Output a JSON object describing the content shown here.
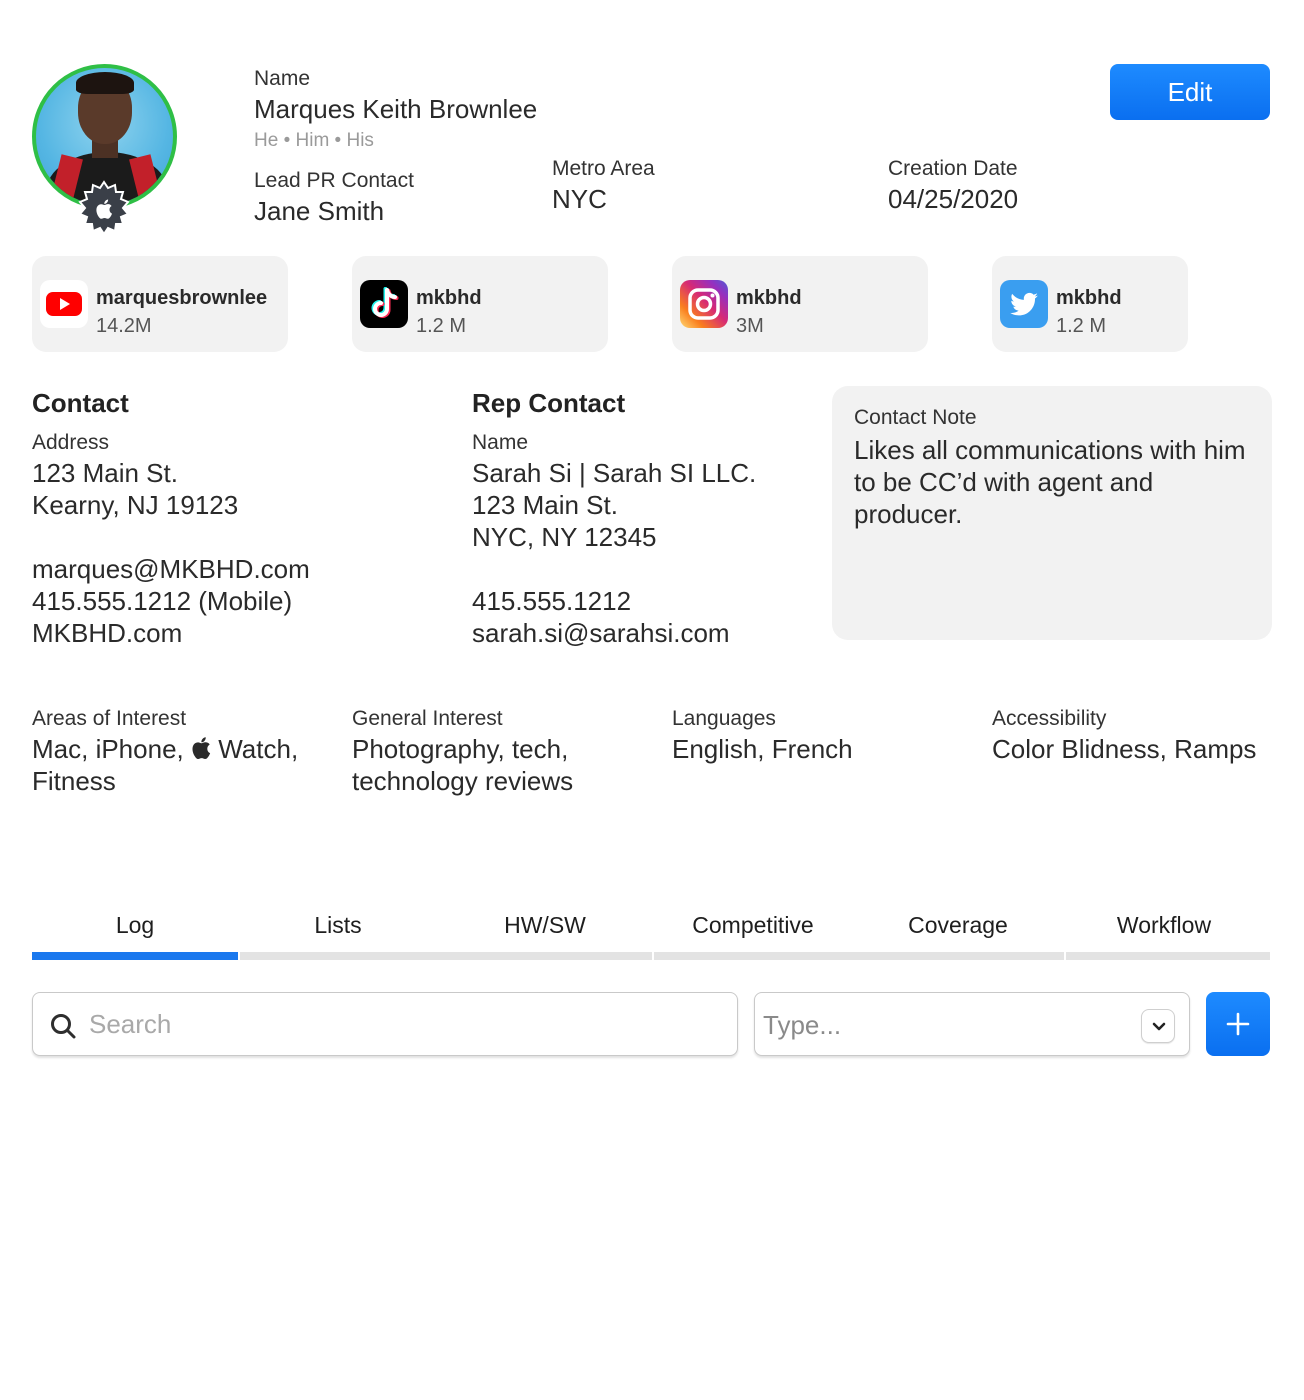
{
  "profile": {
    "name_label": "Name",
    "name": "Marques Keith Brownlee",
    "pronouns": "He • Him • His",
    "lead_pr_label": "Lead PR Contact",
    "lead_pr": "Jane Smith",
    "metro_label": "Metro Area",
    "metro": "NYC",
    "creation_label": "Creation Date",
    "creation_date": "04/25/2020",
    "edit_label": "Edit"
  },
  "socials": [
    {
      "platform": "YouTube",
      "handle": "marquesbrownlee",
      "count": "14.2M"
    },
    {
      "platform": "TikTok",
      "handle": "mkbhd",
      "count": "1.2 M"
    },
    {
      "platform": "Instagram",
      "handle": "mkbhd",
      "count": "3M"
    },
    {
      "platform": "Twitter",
      "handle": "mkbhd",
      "count": "1.2 M"
    }
  ],
  "contact": {
    "heading": "Contact",
    "address_label": "Address",
    "lines": [
      "123 Main St.",
      "Kearny, NJ 19123",
      "",
      "marques@MKBHD.com",
      "415.555.1212 (Mobile)",
      "MKBHD.com"
    ]
  },
  "rep": {
    "heading": "Rep Contact",
    "name_label": "Name",
    "lines": [
      "Sarah Si  | Sarah SI LLC.",
      "123 Main St.",
      "NYC, NY 12345",
      "",
      "415.555.1212",
      "sarah.si@sarahsi.com"
    ]
  },
  "note": {
    "label": "Contact Note",
    "text": "Likes all communications with him to be CC’d with agent and producer."
  },
  "interests": {
    "areas_label": "Areas of Interest",
    "areas_line1_a": "Mac, iPhone,",
    "areas_line1_b": "Watch,",
    "areas_line2": "Fitness",
    "general_label": "General Interest",
    "general_line1": "Photography, tech,",
    "general_line2": "technology reviews",
    "languages_label": "Languages",
    "languages": "English, French",
    "accessibility_label": "Accessibility",
    "accessibility": "Color Blidness, Ramps"
  },
  "tabs": [
    {
      "label": "Log",
      "active": true
    },
    {
      "label": "Lists",
      "active": false
    },
    {
      "label": "HW/SW",
      "active": false
    },
    {
      "label": "Competitive",
      "active": false
    },
    {
      "label": "Coverage",
      "active": false
    },
    {
      "label": "Workflow",
      "active": false
    }
  ],
  "search": {
    "placeholder": "Search"
  },
  "type_select": {
    "placeholder": "Type..."
  },
  "colors": {
    "accent": "#0a6ff0",
    "avatar_ring": "#2fbf46",
    "card_bg": "#f2f2f2",
    "tab_active": "#1a78ee",
    "tab_inactive": "#e3e3e3"
  },
  "icons": {
    "youtube": "youtube-icon",
    "tiktok": "tiktok-icon",
    "instagram": "instagram-icon",
    "twitter": "twitter-icon",
    "search": "search-icon",
    "chevron": "chevron-down-icon",
    "add": "plus-icon",
    "badge": "apple-badge-icon"
  }
}
